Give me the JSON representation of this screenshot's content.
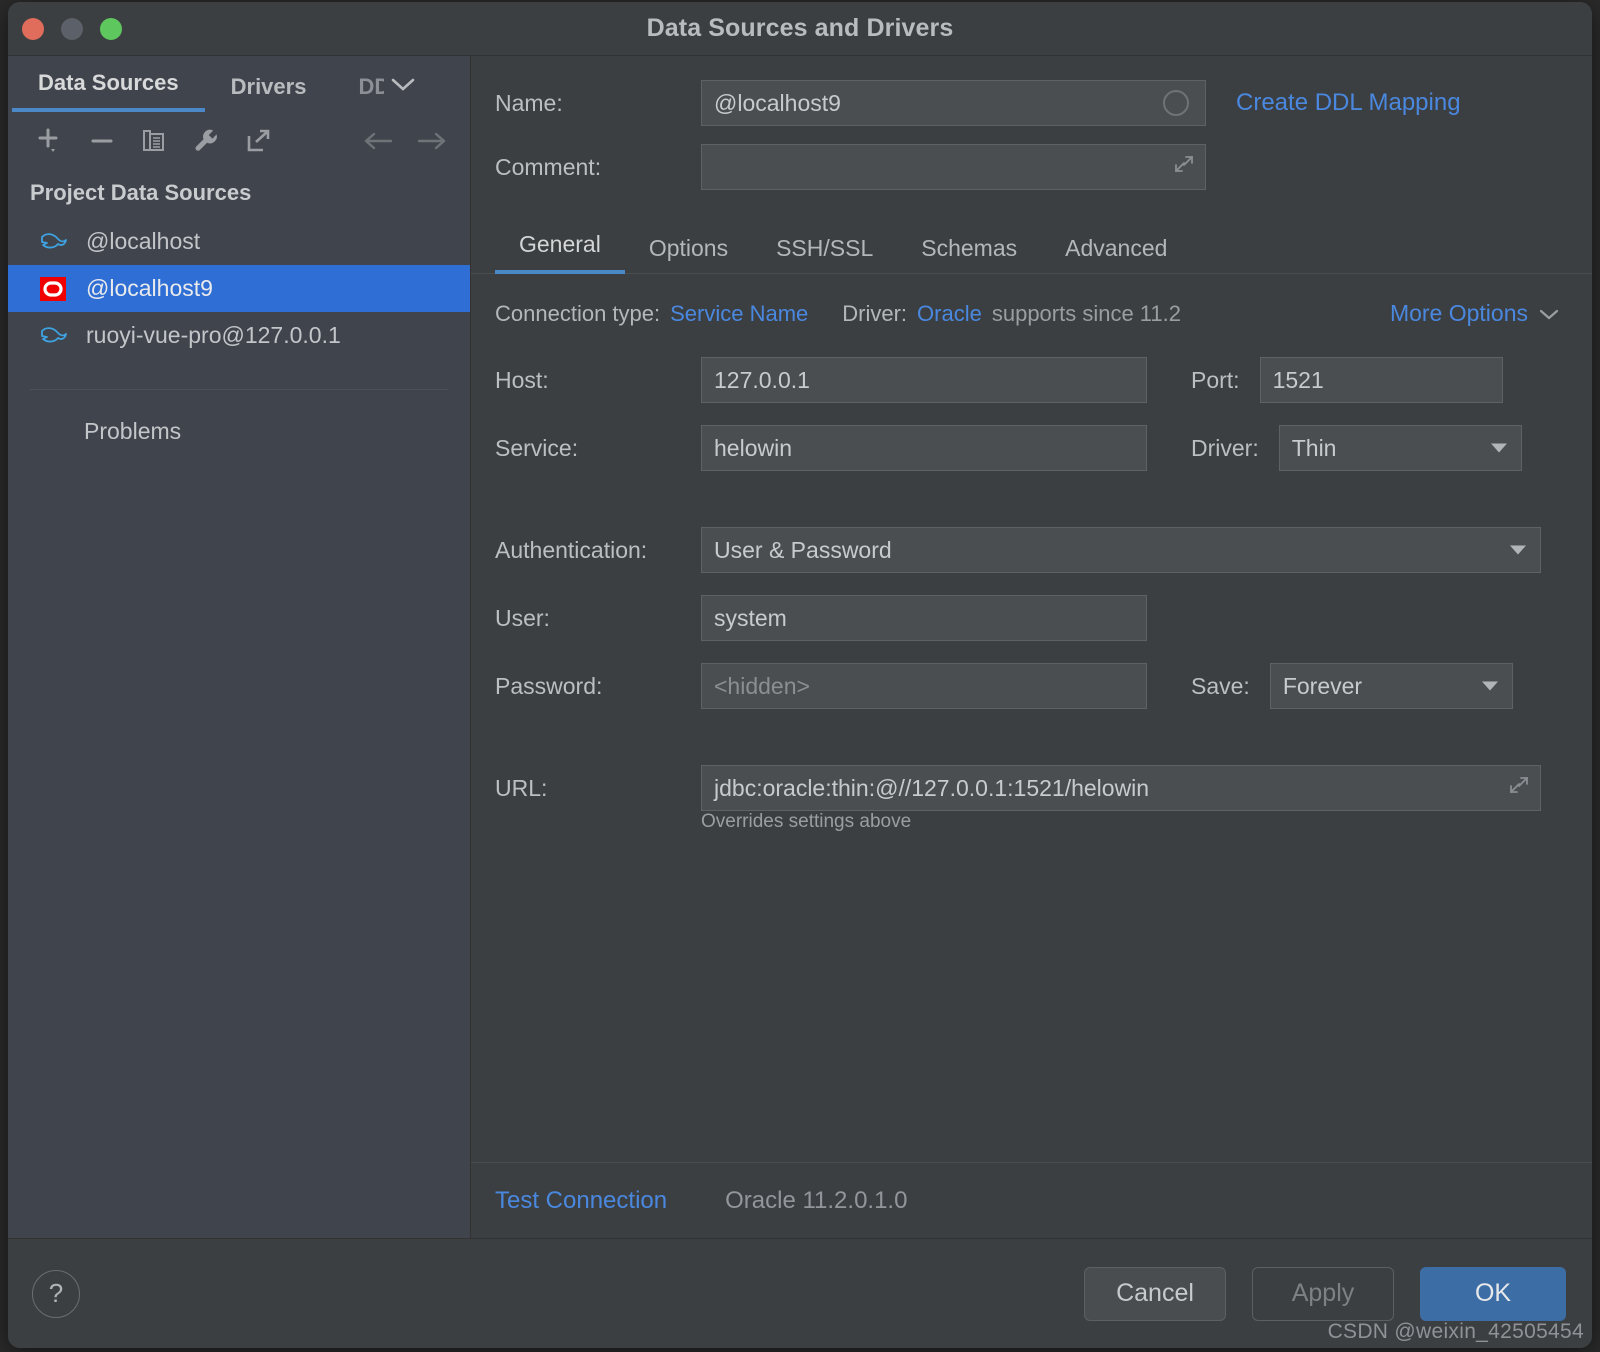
{
  "window": {
    "title": "Data Sources and Drivers",
    "traffic_lights": [
      "close",
      "minimize",
      "zoom"
    ]
  },
  "sidebar": {
    "tabs": [
      {
        "label": "Data Sources",
        "active": true
      },
      {
        "label": "Drivers",
        "active": false
      },
      {
        "label": "DD",
        "active": false,
        "clipped": true
      }
    ],
    "overflow_icon": "chevron-down-icon",
    "toolbar": {
      "icons": [
        "add-icon",
        "remove-icon",
        "copy-icon",
        "wrench-icon",
        "share-icon"
      ],
      "nav": [
        "back-arrow-icon",
        "forward-arrow-icon"
      ]
    },
    "section_title": "Project Data Sources",
    "items": [
      {
        "label": "@localhost",
        "icon": "mysql-dolphin-icon",
        "selected": false
      },
      {
        "label": "@localhost9",
        "icon": "oracle-icon",
        "selected": true
      },
      {
        "label": "ruoyi-vue-pro@127.0.0.1",
        "icon": "mysql-dolphin-icon",
        "selected": false
      }
    ],
    "problems_label": "Problems"
  },
  "main": {
    "name": {
      "label": "Name:",
      "value": "@localhost9",
      "placeholder": ""
    },
    "ddl_link": "Create DDL Mapping",
    "comment": {
      "label": "Comment:",
      "value": "",
      "placeholder": ""
    },
    "tabs": [
      {
        "label": "General",
        "active": true
      },
      {
        "label": "Options",
        "active": false
      },
      {
        "label": "SSH/SSL",
        "active": false
      },
      {
        "label": "Schemas",
        "active": false
      },
      {
        "label": "Advanced",
        "active": false
      }
    ],
    "meta": {
      "connection_type_label": "Connection type:",
      "connection_type_value": "Service Name",
      "driver_label": "Driver:",
      "driver_value": "Oracle",
      "driver_note": "supports since 11.2",
      "more_options": "More Options"
    },
    "fields": {
      "host_label": "Host:",
      "host_value": "127.0.0.1",
      "port_label": "Port:",
      "port_value": "1521",
      "service_label": "Service:",
      "service_value": "helowin",
      "driver_label": "Driver:",
      "driver_value": "Thin",
      "auth_label": "Authentication:",
      "auth_value": "User & Password",
      "user_label": "User:",
      "user_value": "system",
      "password_label": "Password:",
      "password_placeholder": "<hidden>",
      "save_label": "Save:",
      "save_value": "Forever",
      "url_label": "URL:",
      "url_value": "jdbc:oracle:thin:@//127.0.0.1:1521/helowin",
      "url_hint": "Overrides settings above"
    },
    "status": {
      "test_connection": "Test Connection",
      "version": "Oracle 11.2.0.1.0"
    }
  },
  "footer": {
    "help": "?",
    "cancel": "Cancel",
    "apply": "Apply",
    "ok": "OK",
    "watermark": "CSDN @weixin_42505454"
  },
  "colors": {
    "accent_blue": "#4a88e0",
    "selection_blue": "#2f6ed5",
    "primary_button": "#3c6ea5",
    "panel_bg": "#3c3f41",
    "sidebar_bg": "#40444c",
    "input_bg": "#4b4e50"
  }
}
